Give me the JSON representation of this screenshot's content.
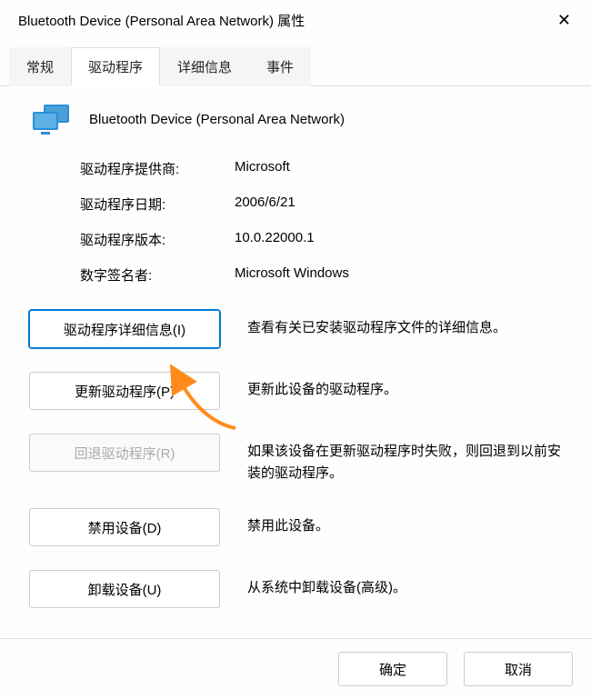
{
  "window": {
    "title": "Bluetooth Device (Personal Area Network) 属性"
  },
  "tabs": {
    "items": [
      {
        "label": "常规"
      },
      {
        "label": "驱动程序"
      },
      {
        "label": "详细信息"
      },
      {
        "label": "事件"
      }
    ],
    "active_index": 1
  },
  "device": {
    "name": "Bluetooth Device (Personal Area Network)"
  },
  "info": {
    "provider_label": "驱动程序提供商:",
    "provider_value": "Microsoft",
    "date_label": "驱动程序日期:",
    "date_value": "2006/6/21",
    "version_label": "驱动程序版本:",
    "version_value": "10.0.22000.1",
    "signer_label": "数字签名者:",
    "signer_value": "Microsoft Windows"
  },
  "actions": {
    "details": {
      "label": "驱动程序详细信息(I)",
      "desc": "查看有关已安装驱动程序文件的详细信息。"
    },
    "update": {
      "label": "更新驱动程序(P)",
      "desc": "更新此设备的驱动程序。"
    },
    "rollback": {
      "label": "回退驱动程序(R)",
      "desc": "如果该设备在更新驱动程序时失败，则回退到以前安装的驱动程序。"
    },
    "disable": {
      "label": "禁用设备(D)",
      "desc": "禁用此设备。"
    },
    "uninstall": {
      "label": "卸载设备(U)",
      "desc": "从系统中卸载设备(高级)。"
    }
  },
  "footer": {
    "ok": "确定",
    "cancel": "取消"
  },
  "annotation": {
    "arrow_color": "#ff8c1a"
  }
}
